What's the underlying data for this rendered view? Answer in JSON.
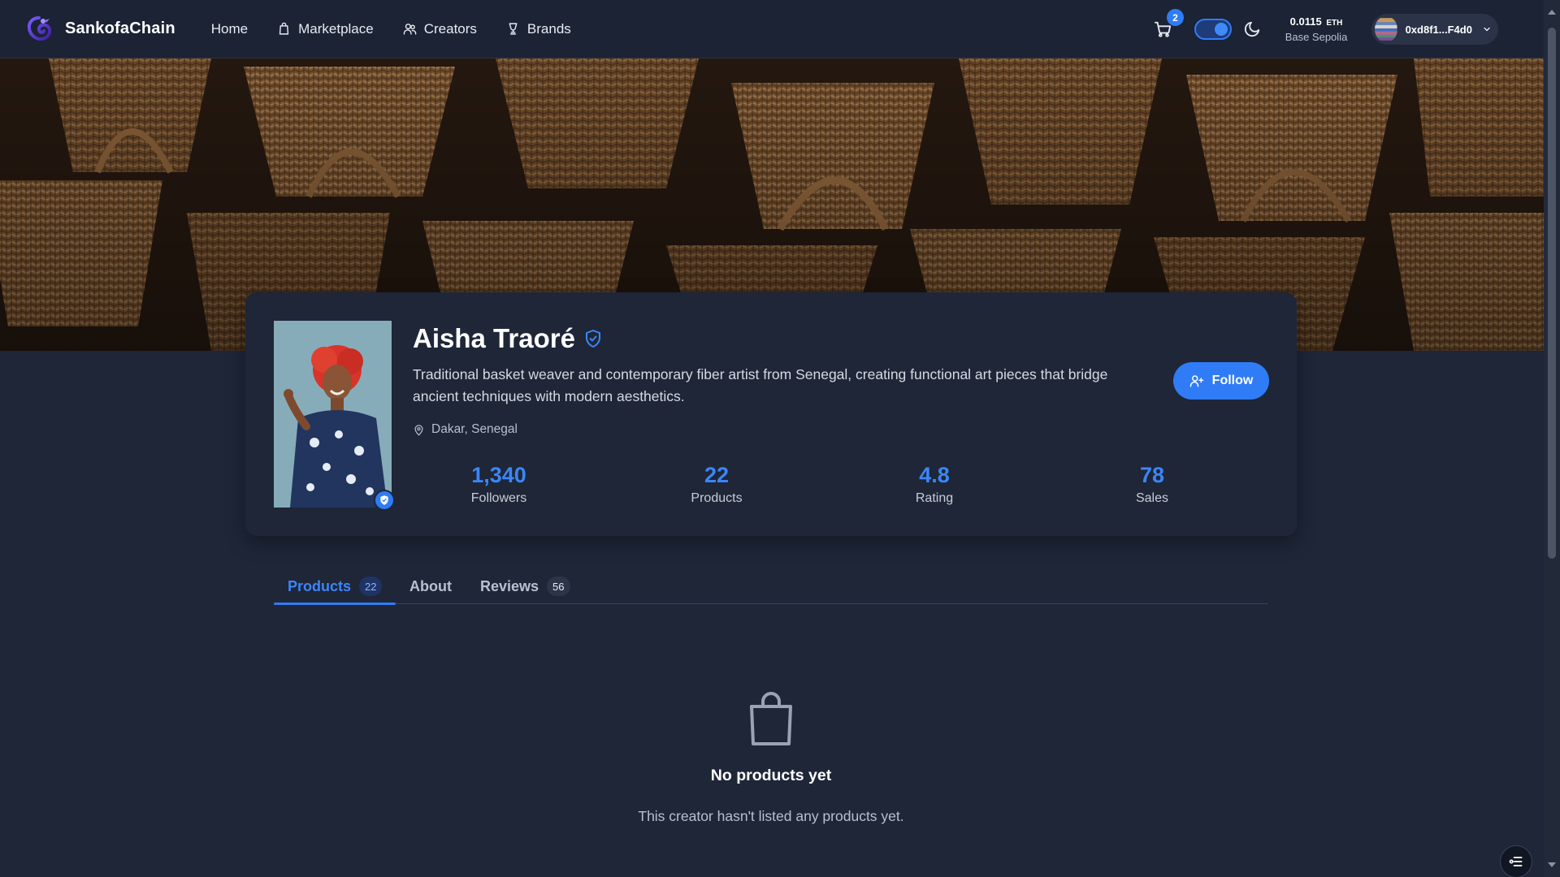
{
  "app": {
    "name": "SankofaChain"
  },
  "nav": {
    "items": [
      {
        "label": "Home"
      },
      {
        "label": "Marketplace",
        "icon": "shopping-bag-icon"
      },
      {
        "label": "Creators",
        "icon": "users-icon"
      },
      {
        "label": "Brands",
        "icon": "brand-trophy-icon"
      }
    ]
  },
  "header": {
    "cart_count": "2",
    "theme_mode": "dark",
    "balance": {
      "amount": "0.0115",
      "unit": "ETH"
    },
    "network": "Base Sepolia",
    "wallet_address": "0xd8f1...F4d0"
  },
  "profile": {
    "name": "Aisha Traoré",
    "verified": true,
    "bio": "Traditional basket weaver and contemporary fiber artist from Senegal, creating functional art pieces that bridge ancient techniques with modern aesthetics.",
    "location": "Dakar, Senegal",
    "follow_label": "Follow",
    "stats": [
      {
        "value": "1,340",
        "label": "Followers"
      },
      {
        "value": "22",
        "label": "Products"
      },
      {
        "value": "4.8",
        "label": "Rating"
      },
      {
        "value": "78",
        "label": "Sales"
      }
    ]
  },
  "tabs": [
    {
      "label": "Products",
      "count": "22",
      "active": true
    },
    {
      "label": "About",
      "count": null,
      "active": false
    },
    {
      "label": "Reviews",
      "count": "56",
      "active": false
    }
  ],
  "empty_state": {
    "icon": "shopping-bag-icon",
    "title": "No products yet",
    "subtitle": "This creator hasn't listed any products yet."
  },
  "colors": {
    "accent": "#2f7cf6",
    "stat_value": "#3b86f7",
    "background": "#1e2638"
  }
}
